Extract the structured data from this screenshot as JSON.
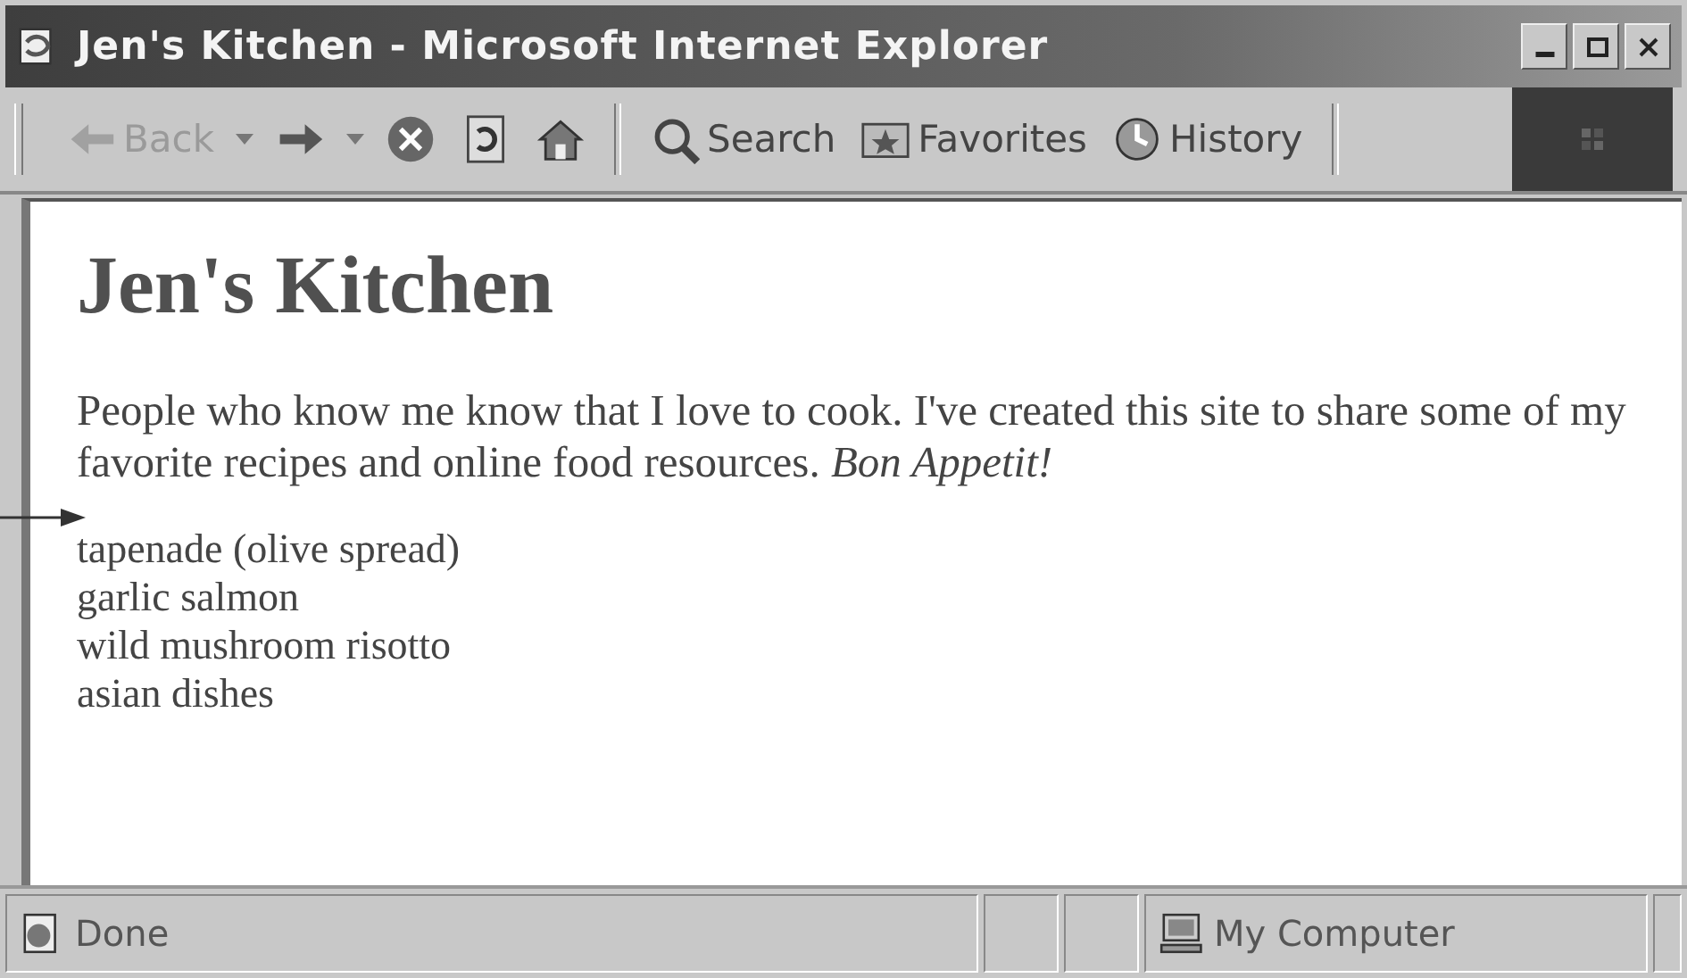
{
  "window": {
    "title": "Jen's Kitchen - Microsoft Internet Explorer"
  },
  "toolbar": {
    "buttons": [
      {
        "kind": "back",
        "label": "Back",
        "disabled": true,
        "dropdown": true
      },
      {
        "kind": "forward",
        "disabled": false,
        "dropdown": true
      },
      {
        "kind": "stop",
        "disabled": false
      },
      {
        "kind": "refresh",
        "disabled": false
      },
      {
        "kind": "home",
        "disabled": false
      },
      {
        "kind": "search",
        "label": "Search",
        "disabled": false
      },
      {
        "kind": "favorites",
        "label": "Favorites",
        "disabled": false
      },
      {
        "kind": "history",
        "label": "History",
        "disabled": false
      }
    ]
  },
  "page": {
    "heading": "Jen's Kitchen",
    "paragraph": "People who know me know that I love to cook. I've created this site to share some of my favorite recipes and online food resources. *Bon Appetit!*",
    "items": [
      "tapenade (olive spread)",
      "garlic salmon",
      "wild mushroom risotto",
      "asian dishes"
    ]
  },
  "status_bar": {
    "status": "Done",
    "zone": "My Computer"
  }
}
